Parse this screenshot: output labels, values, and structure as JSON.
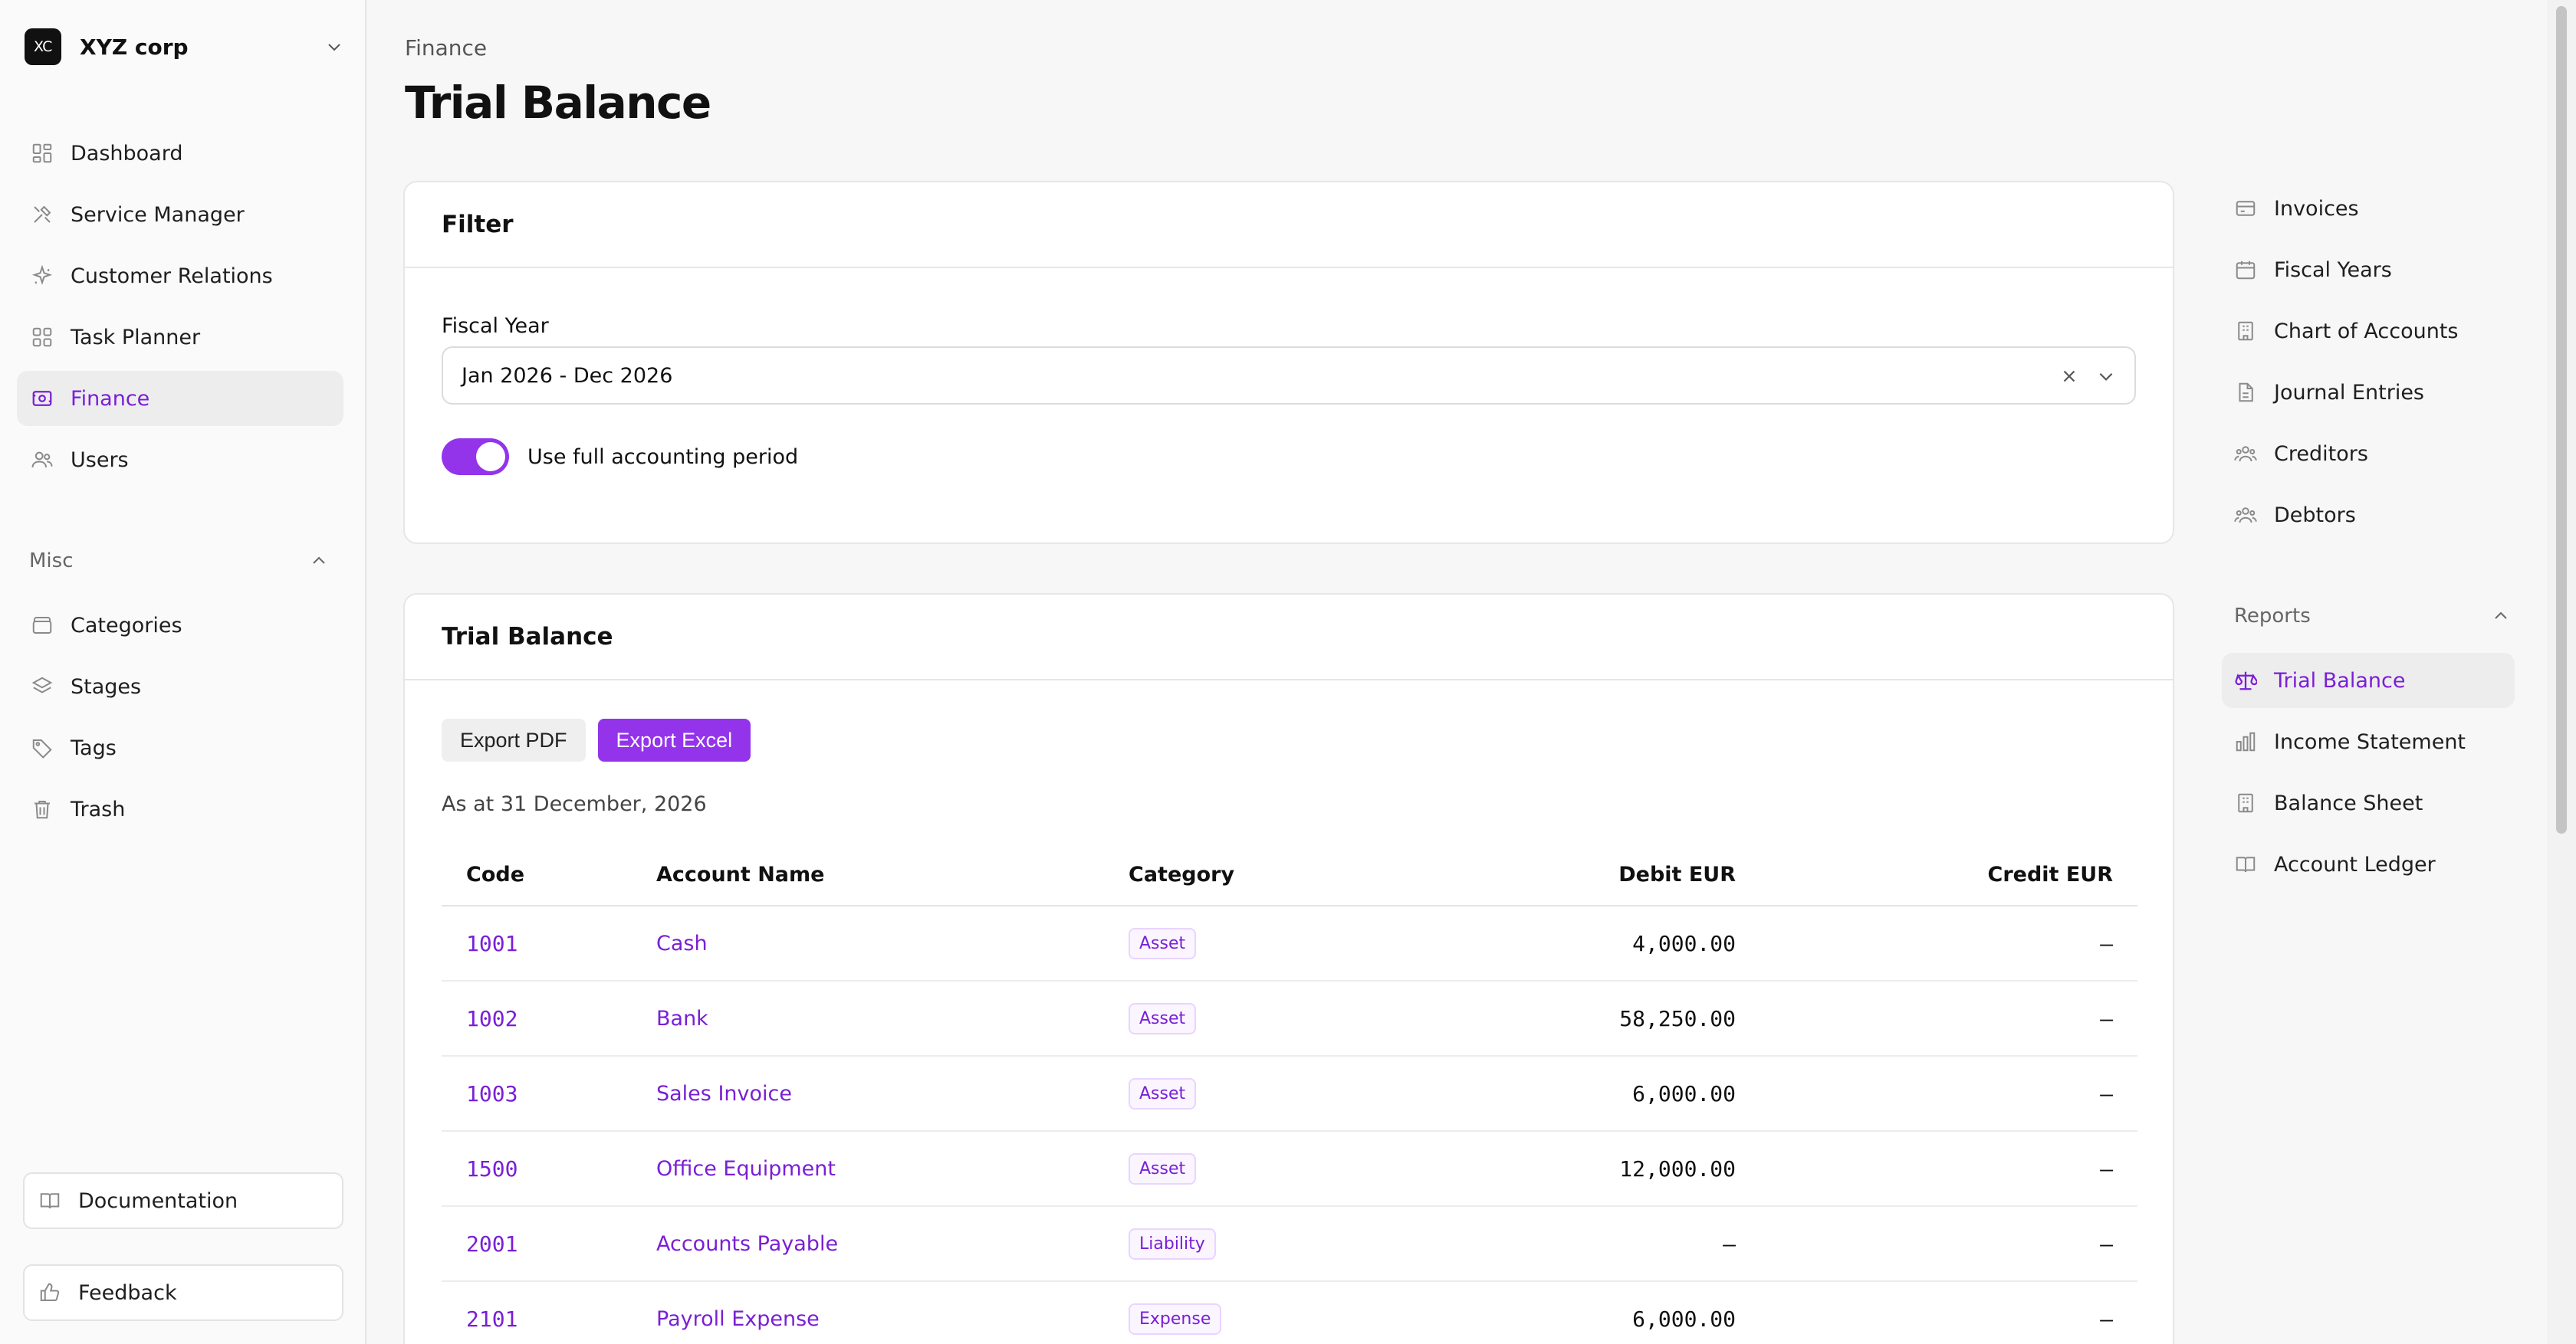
{
  "org": {
    "logo": "XC",
    "name": "XYZ corp"
  },
  "sidebar": {
    "items": [
      {
        "label": "Dashboard",
        "icon": "dashboard-icon"
      },
      {
        "label": "Service Manager",
        "icon": "tools-icon"
      },
      {
        "label": "Customer Relations",
        "icon": "sparkle-icon"
      },
      {
        "label": "Task Planner",
        "icon": "grid-icon"
      },
      {
        "label": "Finance",
        "icon": "wallet-icon",
        "active": true
      },
      {
        "label": "Users",
        "icon": "users-icon"
      }
    ],
    "misc_title": "Misc",
    "misc_items": [
      {
        "label": "Categories",
        "icon": "folder-icon"
      },
      {
        "label": "Stages",
        "icon": "layers-icon"
      },
      {
        "label": "Tags",
        "icon": "tag-icon"
      },
      {
        "label": "Trash",
        "icon": "trash-icon"
      }
    ],
    "documentation": "Documentation",
    "feedback": "Feedback"
  },
  "header": {
    "breadcrumb": "Finance",
    "title": "Trial Balance"
  },
  "filter": {
    "title": "Filter",
    "fiscal_year_label": "Fiscal Year",
    "fiscal_year_value": "Jan 2026 - Dec 2026",
    "toggle_label": "Use full accounting period",
    "toggle_on": true
  },
  "trial_balance": {
    "title": "Trial Balance",
    "export_pdf": "Export PDF",
    "export_excel": "Export Excel",
    "as_at": "As at 31 December, 2026",
    "columns": [
      "Code",
      "Account Name",
      "Category",
      "Debit EUR",
      "Credit EUR"
    ],
    "rows": [
      {
        "code": "1001",
        "name": "Cash",
        "category": "Asset",
        "debit": "4,000.00",
        "credit": "–"
      },
      {
        "code": "1002",
        "name": "Bank",
        "category": "Asset",
        "debit": "58,250.00",
        "credit": "–"
      },
      {
        "code": "1003",
        "name": "Sales Invoice",
        "category": "Asset",
        "debit": "6,000.00",
        "credit": "–"
      },
      {
        "code": "1500",
        "name": "Office Equipment",
        "category": "Asset",
        "debit": "12,000.00",
        "credit": "–"
      },
      {
        "code": "2001",
        "name": "Accounts Payable",
        "category": "Liability",
        "debit": "–",
        "credit": "–"
      },
      {
        "code": "2101",
        "name": "Payroll Expense",
        "category": "Expense",
        "debit": "6,000.00",
        "credit": "–"
      }
    ]
  },
  "subnav": {
    "items": [
      {
        "label": "Invoices",
        "icon": "invoice-icon"
      },
      {
        "label": "Fiscal Years",
        "icon": "calendar-icon"
      },
      {
        "label": "Chart of Accounts",
        "icon": "building-icon"
      },
      {
        "label": "Journal Entries",
        "icon": "document-icon"
      },
      {
        "label": "Creditors",
        "icon": "people-icon"
      },
      {
        "label": "Debtors",
        "icon": "people-icon"
      }
    ],
    "reports_title": "Reports",
    "reports": [
      {
        "label": "Trial Balance",
        "icon": "scale-icon",
        "active": true
      },
      {
        "label": "Income Statement",
        "icon": "bar-chart-icon"
      },
      {
        "label": "Balance Sheet",
        "icon": "building-icon"
      },
      {
        "label": "Account Ledger",
        "icon": "book-icon"
      }
    ]
  },
  "colors": {
    "accent": "#9333ea",
    "accent_text": "#7a1fd6"
  }
}
